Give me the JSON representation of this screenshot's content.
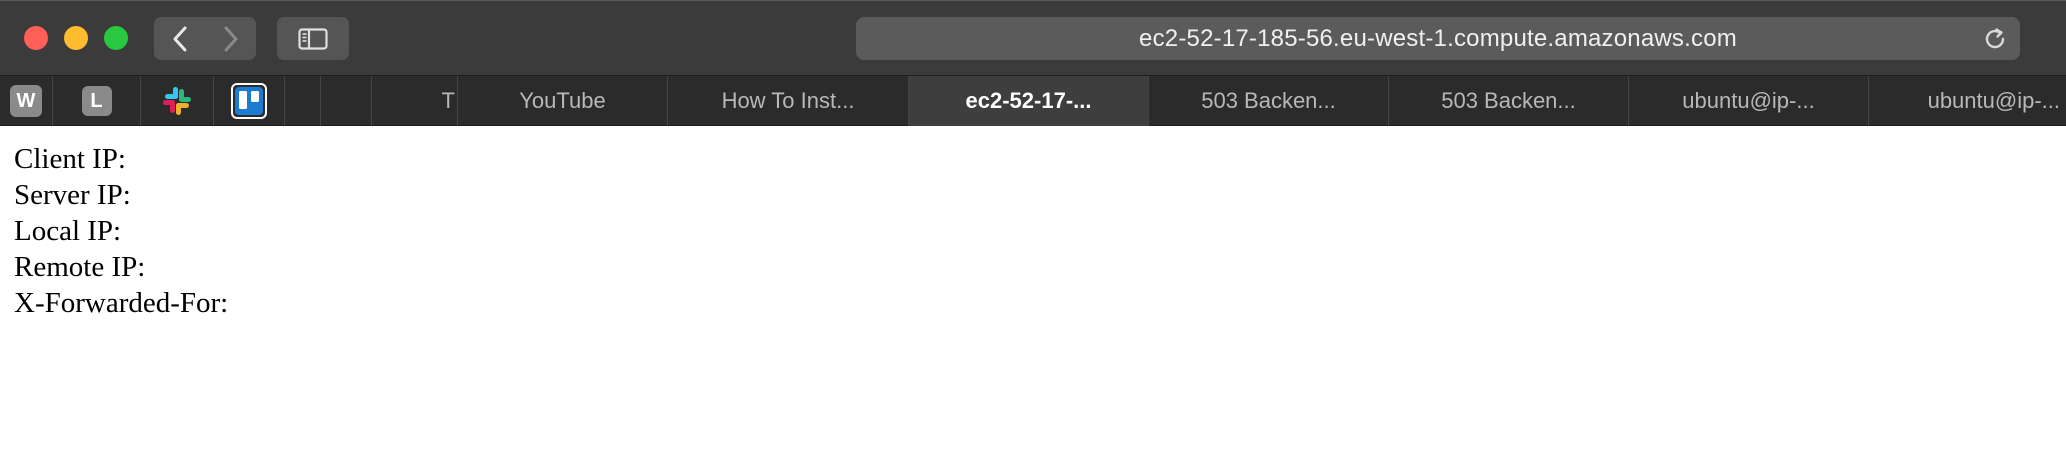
{
  "browser": {
    "address": "ec2-52-17-185-56.eu-west-1.compute.amazonaws.com",
    "pinned_tabs": [
      {
        "label": "W",
        "icon": "w-favicon-icon"
      },
      {
        "label": "L",
        "icon": "l-favicon-icon"
      },
      {
        "label": "",
        "icon": "slack-icon"
      },
      {
        "label": "",
        "icon": "trello-icon"
      }
    ],
    "tabs": [
      {
        "label": "T"
      },
      {
        "label": "YouTube"
      },
      {
        "label": "How To Inst..."
      },
      {
        "label": "ec2-52-17-..."
      },
      {
        "label": "503 Backen..."
      },
      {
        "label": "503 Backen..."
      },
      {
        "label": "ubuntu@ip-..."
      },
      {
        "label": "ubuntu@ip-..."
      }
    ],
    "active_tab_index": 3,
    "colors": {
      "close": "#ff5f57",
      "minimize": "#febc2e",
      "maximize": "#28c840",
      "toolbar": "#3b3b3b",
      "tabbar": "#2b2b2b"
    }
  },
  "page": {
    "lines": [
      "Client IP:",
      "Server IP:",
      "Local IP:",
      "Remote IP:",
      "X-Forwarded-For:"
    ]
  }
}
